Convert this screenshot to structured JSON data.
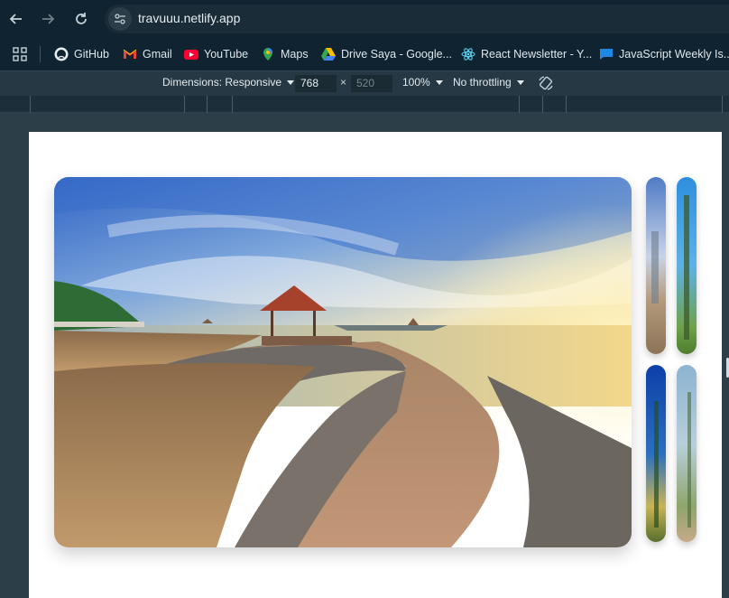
{
  "browser": {
    "url": "travuuu.netlify.app",
    "bookmarks": [
      {
        "label": "GitHub",
        "icon": "github-icon"
      },
      {
        "label": "Gmail",
        "icon": "gmail-icon"
      },
      {
        "label": "YouTube",
        "icon": "youtube-icon"
      },
      {
        "label": "Maps",
        "icon": "maps-icon"
      },
      {
        "label": "Drive Saya - Google...",
        "icon": "drive-icon"
      },
      {
        "label": "React Newsletter - Y...",
        "icon": "react-icon"
      },
      {
        "label": "JavaScript Weekly Is...",
        "icon": "chat-icon"
      }
    ]
  },
  "devtools": {
    "dimensions_label": "Dimensions: Responsive",
    "width": "768",
    "times": "×",
    "height": "520",
    "zoom": "100%",
    "throttling": "No throttling"
  },
  "colors": {
    "chrome_bg": "#0f2430",
    "devbar_bg": "#253843",
    "page_bg": "#ffffff"
  }
}
